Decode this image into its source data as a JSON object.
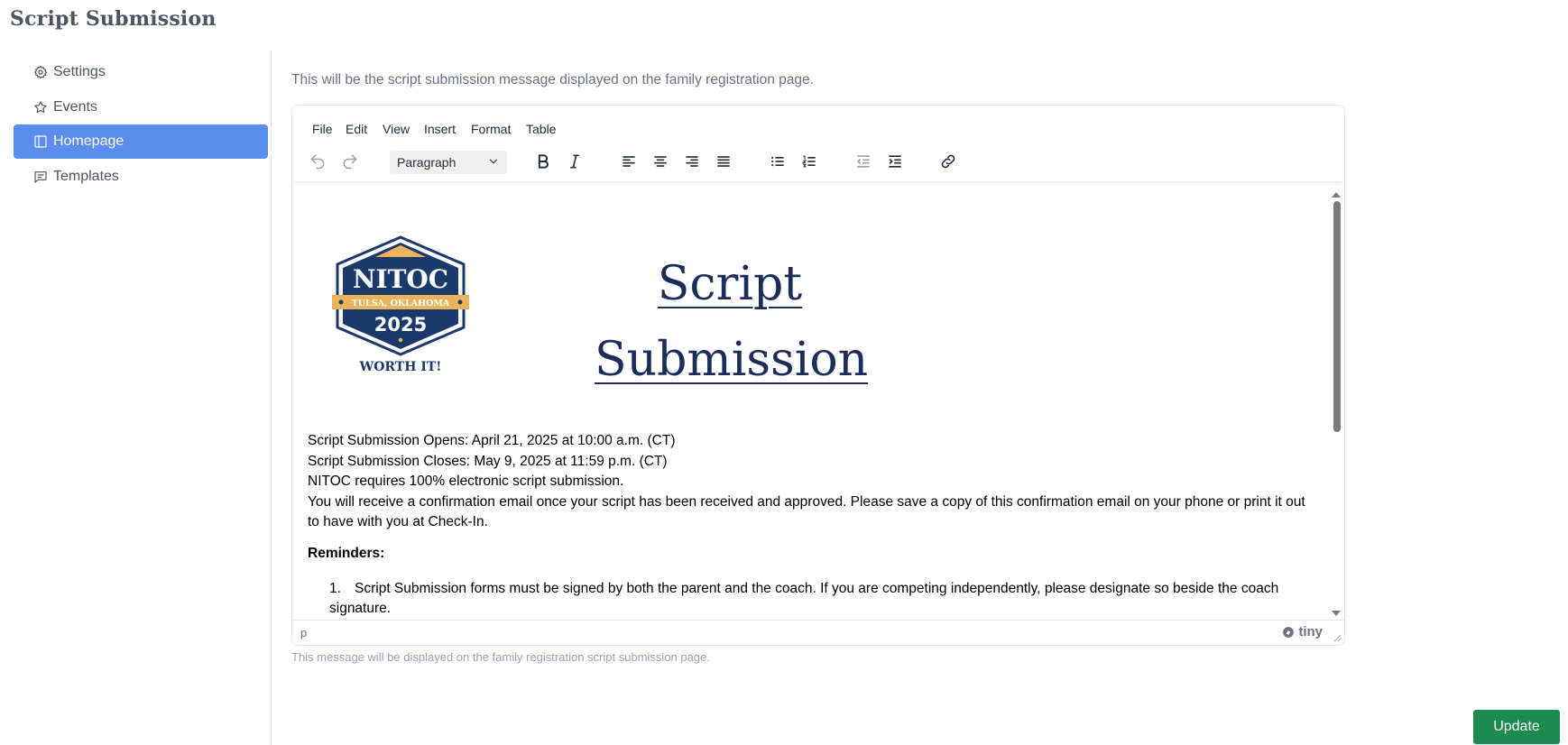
{
  "page": {
    "title": "Script Submission"
  },
  "sidebar": {
    "items": [
      {
        "label": "Settings",
        "icon": "gear-icon",
        "active": false
      },
      {
        "label": "Events",
        "icon": "star-icon",
        "active": false
      },
      {
        "label": "Homepage",
        "icon": "layout-icon",
        "active": true
      },
      {
        "label": "Templates",
        "icon": "message-icon",
        "active": false
      }
    ],
    "active_color": "#5b8def"
  },
  "main": {
    "description": "This will be the script submission message displayed on the family registration page.",
    "help_text": "This message will be displayed on the family registration script submission page.",
    "update_label": "Update",
    "update_color": "#1d8a4e"
  },
  "editor": {
    "menu": [
      "File",
      "Edit",
      "View",
      "Insert",
      "Format",
      "Table"
    ],
    "block_format": "Paragraph",
    "toolbar_icons": [
      "undo-icon",
      "redo-icon",
      "bold-icon",
      "italic-icon",
      "align-left-icon",
      "align-center-icon",
      "align-right-icon",
      "align-justify-icon",
      "bullet-list-icon",
      "numbered-list-icon",
      "outdent-icon",
      "indent-icon",
      "link-icon"
    ],
    "status_path": "p",
    "brand": "tiny",
    "content": {
      "logo": {
        "name": "NITOC",
        "location": "TULSA, OKLAHOMA",
        "year": "2025",
        "tagline": "WORTH IT!",
        "navy": "#1b3a6b",
        "gold": "#e8b35a"
      },
      "heading_line1": "Script",
      "heading_line2": "Submission",
      "lines": [
        "Script Submission Opens: April 21, 2025 at 10:00 a.m. (CT)",
        "Script Submission Closes: May 9, 2025 at 11:59 p.m. (CT)",
        "NITOC requires 100% electronic script submission.",
        "You will receive a confirmation email once your script has been received and approved. Please save a copy of this confirmation email on your phone or print it out to have with you at Check-In."
      ],
      "reminders_label": "Reminders:",
      "reminders": [
        {
          "num": "1.",
          "text": "Script Submission forms must be signed by both the parent and the coach. If you are competing independently, please designate so beside the coach signature."
        }
      ]
    }
  }
}
